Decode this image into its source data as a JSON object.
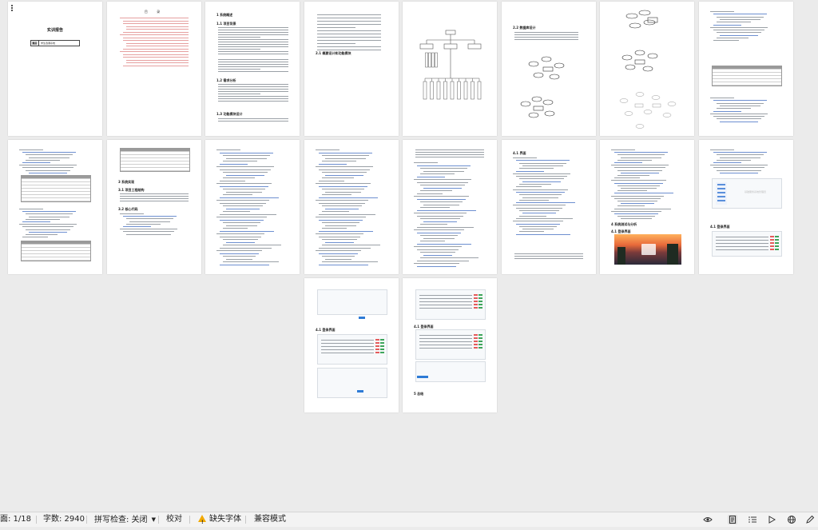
{
  "status_bar": {
    "page": "面: 1/18",
    "word_count": "字数: 2940",
    "spell_check": "拼写检查: 关闭",
    "proofread": "校对",
    "missing_fonts": "缺失字体",
    "compat_mode": "兼容模式"
  },
  "view_icons": [
    "eye-icon",
    "page-view-icon",
    "outline-icon",
    "play-icon",
    "web-icon",
    "pen-icon"
  ],
  "doc_pages": {
    "cover": {
      "title": "实训报告",
      "field_key": "题目",
      "field_value": "学生选课系统"
    },
    "toc": {
      "title": "目 录"
    },
    "p3": {
      "h1": "1 系统概述",
      "h2a": "1.1 项目背景",
      "h2b": "1.2 需求分析",
      "h2c": "1.3 功能模块设计"
    },
    "p4": {
      "h2": "2.1 概要设计和功能模块"
    },
    "p6": {
      "h2": "2.2 数据库设计"
    },
    "p10": {
      "h1": "3 系统实现",
      "h2a": "3.1 项目工程结构",
      "h2b": "3.2 核心代码"
    },
    "p15": {
      "h2": "4.1 界面"
    },
    "p16": {
      "h1": "4 系统测试与分析"
    },
    "p17": {
      "h2": "4.1 登录界面"
    },
    "p18": {
      "h1": "5 总结"
    },
    "login_text": "基础服务系统管理员"
  },
  "colors": {
    "page_bg": "#ebebeb",
    "link_blue": "#2e7bd6",
    "status_bg": "#f3f3f3",
    "warn": "#f2a900"
  }
}
